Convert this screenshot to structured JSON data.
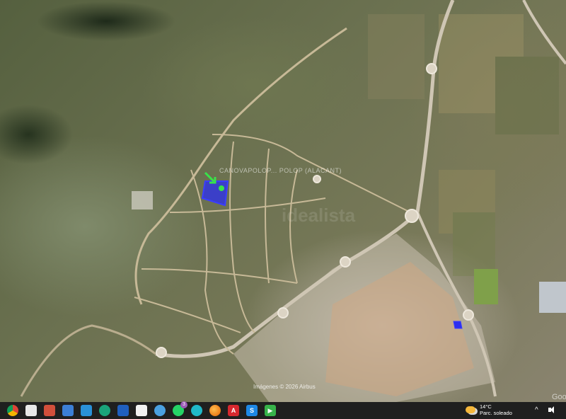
{
  "map": {
    "parcel_label": "CANOVAPOLOP... POLOP (ALACANT)",
    "watermark": "idealista",
    "copyright": "Imágenes © 2026 Airbus",
    "logo": "Google"
  },
  "taskbar": {
    "icons": [
      "chrome-icon",
      "explorer-file-icon",
      "gallery-icon",
      "app-icon",
      "photos-icon",
      "edge-icon",
      "folder-icon",
      "notepad-icon",
      "browser-icon",
      "whatsapp-icon",
      "onedrive-icon",
      "firefox-icon",
      "acrobat-icon",
      "s-app-icon",
      "sticky-app-icon"
    ],
    "whatsapp_badge": "3",
    "weather": {
      "temp": "14°C",
      "condition": "Parc. soleado"
    }
  },
  "colors": {
    "parcel_fill": "#2b2ff0",
    "marker": "#38e34a",
    "road": "#cfc6b4",
    "taskbar": "#1f1f1f"
  }
}
